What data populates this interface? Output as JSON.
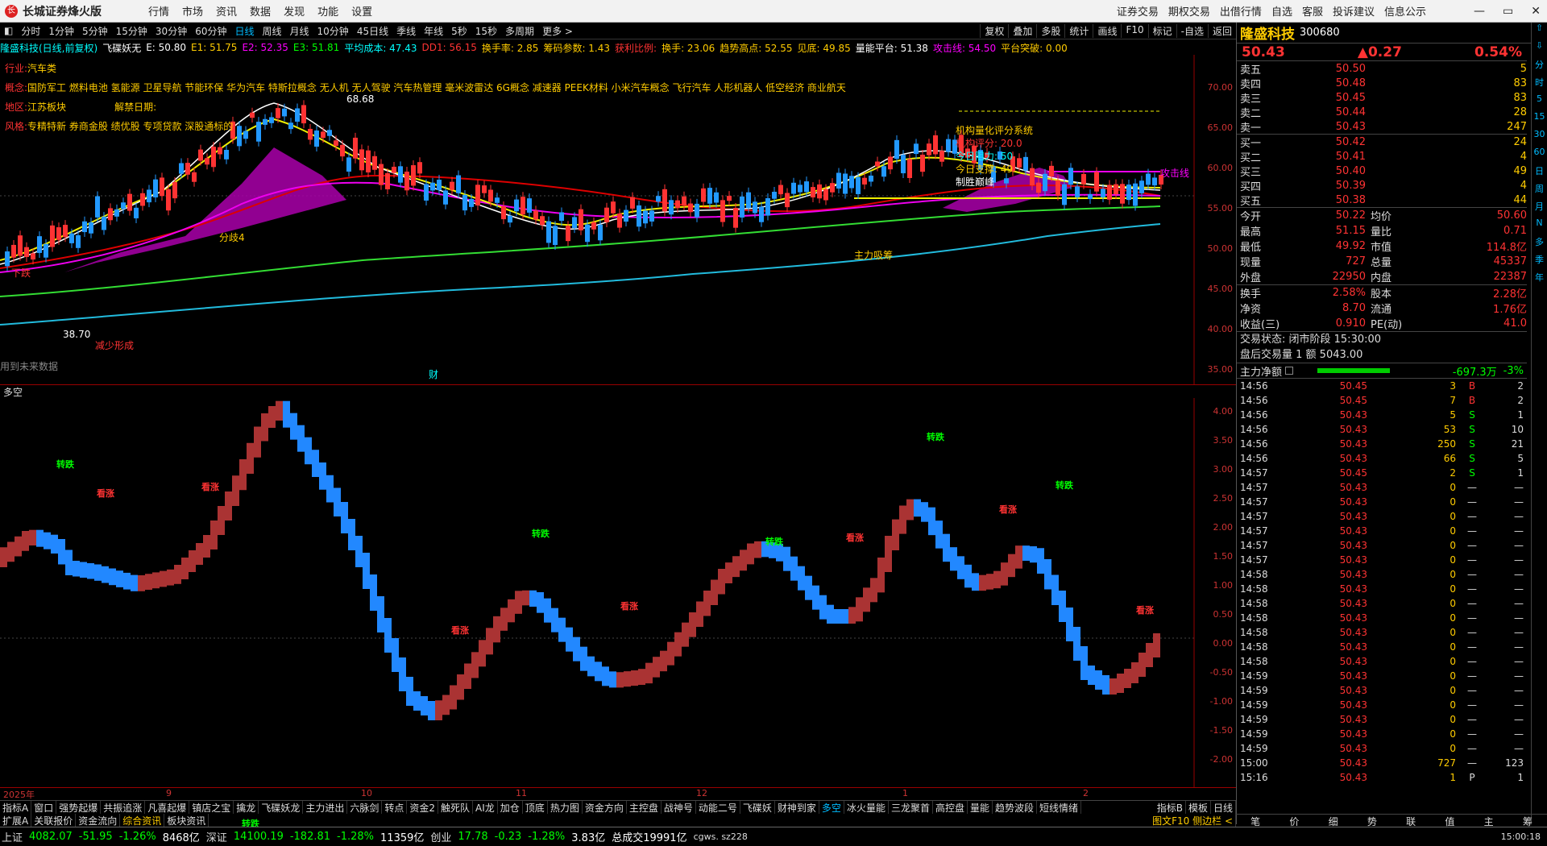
{
  "app": {
    "title": "长城证券烽火版",
    "logo": "长"
  },
  "menu": [
    "行情",
    "市场",
    "资讯",
    "数据",
    "发现",
    "功能",
    "设置"
  ],
  "right_menu": [
    "证券交易",
    "期权交易",
    "出借行情",
    "自选",
    "客服",
    "投诉建议",
    "信息公示"
  ],
  "window_controls": [
    "—",
    "▭",
    "✕"
  ],
  "periods": [
    "分时",
    "1分钟",
    "5分钟",
    "15分钟",
    "30分钟",
    "60分钟",
    "日线",
    "周线",
    "月线",
    "10分钟",
    "45日线",
    "季线",
    "年线",
    "5秒",
    "15秒",
    "多周期",
    "更多 >"
  ],
  "active_period": "日线",
  "right_tools": [
    "复权",
    "叠加",
    "多股",
    "统计",
    "画线",
    "F10",
    "标记",
    "-自选",
    "返回"
  ],
  "info": {
    "stock": "隆盛科技(日线,前复权)",
    "indicator": "飞碟妖无",
    "e": "E: 50.80",
    "e1": "E1: 51.75",
    "e2": "E2: 52.35",
    "e3": "E3: 51.81",
    "avg_cost": "平均成本: 47.43",
    "dd1": "DD1: 56.15",
    "turnover": "换手率: 2.85",
    "chip": "筹码参数: 1.43",
    "profit": "获利比例:",
    "hs": "换手: 23.06",
    "trend": "趋势高点: 52.55",
    "low": "见底: 49.85",
    "platform": "量能平台: 51.38",
    "attack": "攻击线: 54.50",
    "break": "平台突破: 0.00"
  },
  "tags": {
    "industry_label": "行业:",
    "industry": "汽车类",
    "concept_label": "概念:",
    "concept": "国防军工 燃料电池 氢能源 卫星导航 节能环保 华为汽车 特斯拉概念 无人机 无人驾驶 汽车热管理 毫米波雷达 6G概念 减速器 PEEK材料 小米汽车概念 飞行汽车 人形机器人 低空经济 商业航天",
    "region_label": "地区:",
    "region": "江苏板块",
    "unlock_label": "解禁日期:",
    "style_label": "风格:",
    "style": "专精特新 券商金股 绩优股 专项贷款 深股通标的"
  },
  "panel_box": {
    "title": "机构量化评分系统",
    "score": "机构评分:  20.0",
    "resist": "今日阻力:  50",
    "support": "今日支撑:  49",
    "break": "制胜巅峰"
  },
  "chart_labels": {
    "peak": "68.68",
    "bottom": "38.70",
    "attack_line": "攻击线",
    "fenqi": "分歧4",
    "main_accum": "主力吸筹",
    "lower_title": "多空",
    "future_data": "用到未来数据",
    "cai": "财",
    "xiadie": "下跌",
    "jiaxing": "减少形成"
  },
  "yaxis_main": [
    "70.00",
    "65.00",
    "60.00",
    "55.00",
    "50.00",
    "45.00",
    "40.00",
    "35.00"
  ],
  "yaxis_low": [
    "4.00",
    "3.50",
    "3.00",
    "2.50",
    "2.00",
    "1.50",
    "1.00",
    "0.50",
    "0.00",
    "-0.50",
    "-1.00",
    "-1.50",
    "-2.00"
  ],
  "xaxis": [
    "2025年",
    "9",
    "10",
    "11",
    "12",
    "1",
    "2"
  ],
  "low_labels": {
    "down": "转跌",
    "up": "看涨"
  },
  "stock": {
    "name": "隆盛科技",
    "code": "300680",
    "price": "50.43",
    "change": "▲0.27",
    "pct": "0.54%",
    "asks": [
      [
        "卖五",
        "50.50",
        "5"
      ],
      [
        "卖四",
        "50.48",
        "83"
      ],
      [
        "卖三",
        "50.45",
        "83"
      ],
      [
        "卖二",
        "50.44",
        "28"
      ],
      [
        "卖一",
        "50.43",
        "247"
      ]
    ],
    "bids": [
      [
        "买一",
        "50.42",
        "24"
      ],
      [
        "买二",
        "50.41",
        "4"
      ],
      [
        "买三",
        "50.40",
        "49"
      ],
      [
        "买四",
        "50.39",
        "4"
      ],
      [
        "买五",
        "50.38",
        "44"
      ]
    ],
    "quote": [
      [
        "今开",
        "50.22",
        "均价",
        "50.60"
      ],
      [
        "最高",
        "51.15",
        "量比",
        "0.71"
      ],
      [
        "最低",
        "49.92",
        "市值",
        "114.8亿"
      ],
      [
        "现量",
        "727",
        "总量",
        "45337"
      ],
      [
        "外盘",
        "22950",
        "内盘",
        "22387"
      ]
    ],
    "quote2": [
      [
        "换手",
        "2.58%",
        "股本",
        "2.28亿"
      ],
      [
        "净资",
        "8.70",
        "流通",
        "1.76亿"
      ],
      [
        "收益(三)",
        "0.910",
        "PE(动)",
        "41.0"
      ]
    ],
    "trade_status": "交易状态:  闭市阶段  15:30:00",
    "after_hours": "盘后交易量  1  额  5043.00",
    "main_flow_label": "主力净额",
    "main_flow": "-697.3万",
    "main_flow_pct": "-3%"
  },
  "ticks": [
    [
      "14:56",
      "50.45",
      "3",
      "B",
      "2"
    ],
    [
      "14:56",
      "50.45",
      "7",
      "B",
      "2"
    ],
    [
      "14:56",
      "50.43",
      "5",
      "S",
      "1"
    ],
    [
      "14:56",
      "50.43",
      "53",
      "S",
      "10"
    ],
    [
      "14:56",
      "50.43",
      "250",
      "S",
      "21"
    ],
    [
      "14:56",
      "50.43",
      "66",
      "S",
      "5"
    ],
    [
      "14:57",
      "50.45",
      "2",
      "S",
      "1"
    ],
    [
      "14:57",
      "50.43",
      "0",
      "—",
      "—"
    ],
    [
      "14:57",
      "50.43",
      "0",
      "—",
      "—"
    ],
    [
      "14:57",
      "50.43",
      "0",
      "—",
      "—"
    ],
    [
      "14:57",
      "50.43",
      "0",
      "—",
      "—"
    ],
    [
      "14:57",
      "50.43",
      "0",
      "—",
      "—"
    ],
    [
      "14:57",
      "50.43",
      "0",
      "—",
      "—"
    ],
    [
      "14:58",
      "50.43",
      "0",
      "—",
      "—"
    ],
    [
      "14:58",
      "50.43",
      "0",
      "—",
      "—"
    ],
    [
      "14:58",
      "50.43",
      "0",
      "—",
      "—"
    ],
    [
      "14:58",
      "50.43",
      "0",
      "—",
      "—"
    ],
    [
      "14:58",
      "50.43",
      "0",
      "—",
      "—"
    ],
    [
      "14:58",
      "50.43",
      "0",
      "—",
      "—"
    ],
    [
      "14:58",
      "50.43",
      "0",
      "—",
      "—"
    ],
    [
      "14:59",
      "50.43",
      "0",
      "—",
      "—"
    ],
    [
      "14:59",
      "50.43",
      "0",
      "—",
      "—"
    ],
    [
      "14:59",
      "50.43",
      "0",
      "—",
      "—"
    ],
    [
      "14:59",
      "50.43",
      "0",
      "—",
      "—"
    ],
    [
      "14:59",
      "50.43",
      "0",
      "—",
      "—"
    ],
    [
      "14:59",
      "50.43",
      "0",
      "—",
      "—"
    ],
    [
      "15:00",
      "50.43",
      "727",
      "—",
      "123"
    ],
    [
      "15:16",
      "50.43",
      "1",
      "P",
      "1"
    ]
  ],
  "vbar": [
    "⇧",
    "⇩",
    "分",
    "时",
    "5",
    "15",
    "30",
    "60",
    "日",
    "周",
    "月",
    "N",
    "多",
    "季",
    "年"
  ],
  "tabs1": [
    "指标A",
    "窗口",
    "强势起爆",
    "共振追涨",
    "凡喜起爆",
    "镇店之宝",
    "擒龙",
    "飞碟妖龙",
    "主力进出",
    "六脉剑",
    "转点",
    "资金2",
    "触死队",
    "AI龙",
    "加仓",
    "顶底",
    "热力图",
    "资金方向",
    "主控盘",
    "战神号",
    "动能二号",
    "飞碟妖",
    "财神到家",
    "多空",
    "冰火量能",
    "三龙聚首",
    "高控盘",
    "量能",
    "趋势波段",
    "短线情绪"
  ],
  "tabs1_active": "多空",
  "tabs1_right": [
    "指标B",
    "模板",
    "日线"
  ],
  "tabs2": [
    "扩展A",
    "关联报价",
    "资金流向",
    "综合资讯",
    "板块资讯"
  ],
  "tabs2_active": "综合资讯",
  "tabs2_right": "图文F10 侧边栏 <",
  "rtabs": [
    "笔",
    "价",
    "细",
    "势",
    "联",
    "值",
    "主",
    "筹"
  ],
  "status": {
    "sh": "上证",
    "sh_v": "4082.07",
    "sh_c": "-51.95",
    "sh_p": "-1.26%",
    "sh_a": "8468亿",
    "sz": "深证",
    "sz_v": "14100.19",
    "sz_c": "-182.81",
    "sz_p": "-1.28%",
    "sz_a": "11359亿",
    "cy": "创业",
    "cy_v": "17.78",
    "cy_c": "-0.23",
    "cy_p": "-1.28%",
    "cy_a": "3.83亿",
    "total": "总成交19991亿",
    "server": "cgws. sz228",
    "time": "15:00:18"
  },
  "colors": {
    "up": "#ff3333",
    "down": "#00ff00",
    "accent": "#00bbff",
    "bg": "#000000"
  }
}
